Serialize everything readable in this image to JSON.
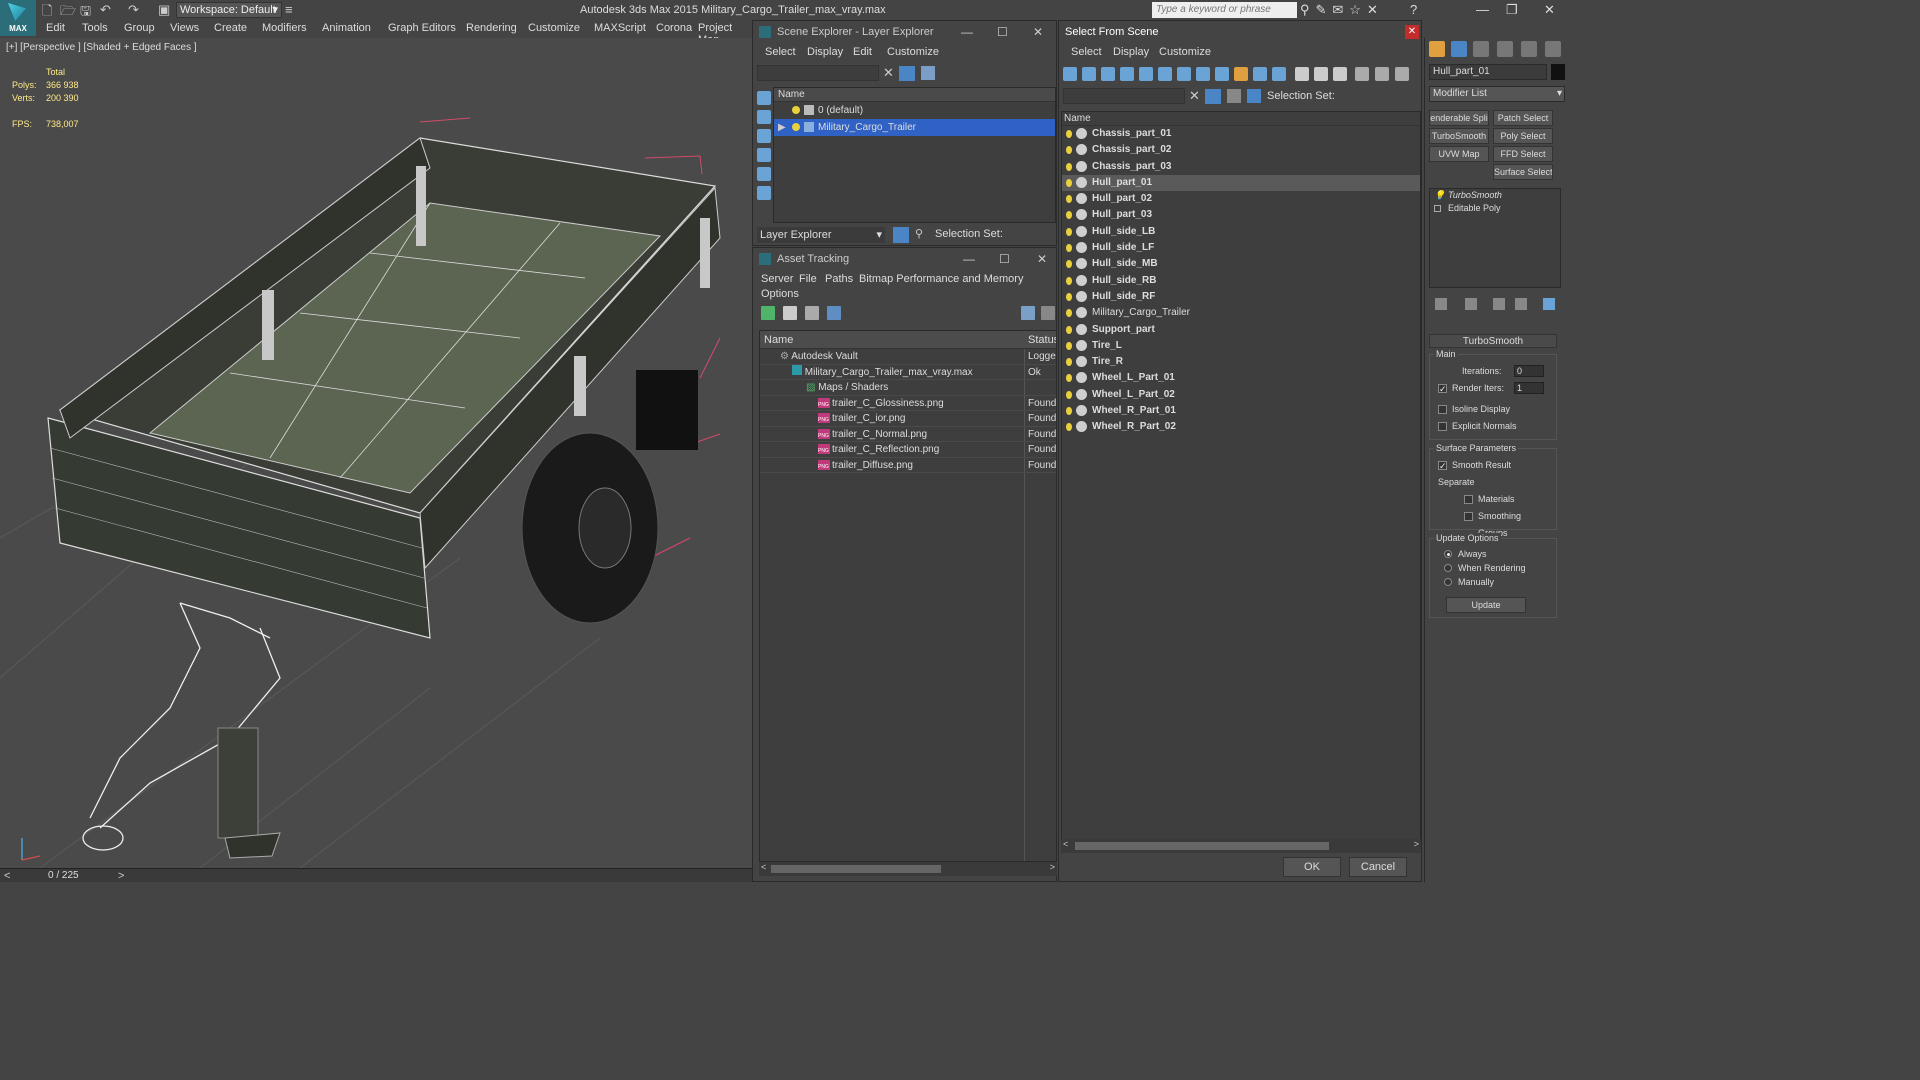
{
  "app": {
    "title": "Autodesk 3ds Max  2015     Military_Cargo_Trailer_max_vray.max",
    "logo_text": "MAX",
    "workspace": "Workspace: Default",
    "search_placeholder": "Type a keyword or phrase"
  },
  "menu": [
    "Edit",
    "Tools",
    "Group",
    "Views",
    "Create",
    "Modifiers",
    "Animation",
    "Graph Editors",
    "Rendering",
    "Customize",
    "MAXScript",
    "Corona",
    "Project Man"
  ],
  "viewport": {
    "label": "[+] [Perspective ] [Shaded + Edged Faces ]",
    "stats": {
      "total_label": "Total",
      "polys_label": "Polys:",
      "polys_value": "366 938",
      "verts_label": "Verts:",
      "verts_value": "200 390",
      "fps_label": "FPS:",
      "fps_value": "738,007"
    },
    "frame": "0 / 225"
  },
  "scene_explorer": {
    "title": "Scene Explorer - Layer Explorer",
    "menu": [
      "Select",
      "Display",
      "Edit",
      "Customize"
    ],
    "column": "Name",
    "rows": [
      "0 (default)",
      "Military_Cargo_Trailer"
    ],
    "footer_label": "Layer Explorer",
    "selection_set": "Selection Set:"
  },
  "asset_tracking": {
    "title": "Asset Tracking",
    "menu": [
      "Server",
      "File",
      "Paths",
      "Bitmap Performance and Memory",
      "Options"
    ],
    "col_name": "Name",
    "col_status": "Status",
    "rows": [
      {
        "name": "Autodesk Vault",
        "status": "Logge",
        "indent": 0
      },
      {
        "name": "Military_Cargo_Trailer_max_vray.max",
        "status": "Ok",
        "indent": 1
      },
      {
        "name": "Maps / Shaders",
        "status": "",
        "indent": 2
      },
      {
        "name": "trailer_C_Glossiness.png",
        "status": "Found",
        "indent": 3
      },
      {
        "name": "trailer_C_ior.png",
        "status": "Found",
        "indent": 3
      },
      {
        "name": "trailer_C_Normal.png",
        "status": "Found",
        "indent": 3
      },
      {
        "name": "trailer_C_Reflection.png",
        "status": "Found",
        "indent": 3
      },
      {
        "name": "trailer_Diffuse.png",
        "status": "Found",
        "indent": 3
      }
    ]
  },
  "select_from_scene": {
    "title": "Select From Scene",
    "menu": [
      "Select",
      "Display",
      "Customize"
    ],
    "selection_set": "Selection Set:",
    "column": "Name",
    "objects": [
      "Chassis_part_01",
      "Chassis_part_02",
      "Chassis_part_03",
      "Hull_part_01",
      "Hull_part_02",
      "Hull_part_03",
      "Hull_side_LB",
      "Hull_side_LF",
      "Hull_side_MB",
      "Hull_side_RB",
      "Hull_side_RF",
      "Military_Cargo_Trailer",
      "Support_part",
      "Tire_L",
      "Tire_R",
      "Wheel_L_Part_01",
      "Wheel_L_Part_02",
      "Wheel_R_Part_01",
      "Wheel_R_Part_02"
    ],
    "ok": "OK",
    "cancel": "Cancel"
  },
  "command_panel": {
    "object_name": "Hull_part_01",
    "modifier_list": "Modifier List",
    "buttons": [
      "enderable Spli",
      "Patch Select",
      "TurboSmooth",
      "Poly Select",
      "UVW Map",
      "FFD Select",
      "Surface Select"
    ],
    "stack": [
      "TurboSmooth",
      "Editable Poly"
    ],
    "turbosmooth": {
      "title": "TurboSmooth",
      "main": "Main",
      "iterations_label": "Iterations:",
      "iterations": "0",
      "render_iters_label": "Render Iters:",
      "render_iters": "1",
      "isoline": "Isoline Display",
      "explicit": "Explicit Normals",
      "surface_params": "Surface Parameters",
      "smooth_result": "Smooth Result",
      "separate": "Separate",
      "materials": "Materials",
      "smoothing_groups": "Smoothing Groups",
      "update_options": "Update Options",
      "always": "Always",
      "when_rendering": "When Rendering",
      "manually": "Manually",
      "update": "Update"
    }
  }
}
